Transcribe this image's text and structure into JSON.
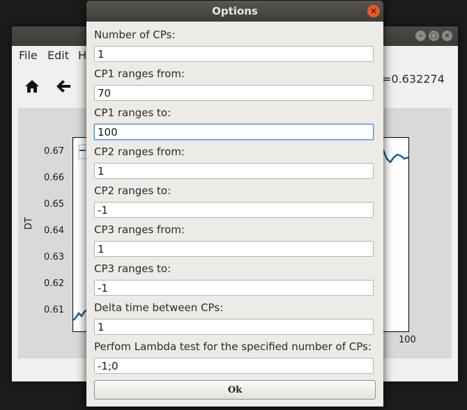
{
  "background_window": {
    "menu": [
      {
        "label": "File"
      },
      {
        "label": "Edit"
      },
      {
        "label": "H"
      }
    ],
    "toolbar": {
      "home_icon": "home-icon",
      "back_icon": "back-arrow-icon"
    },
    "coordinate_readout": "=0.632274",
    "plot": {
      "ylabel": "DT",
      "yticks": [
        "0.67",
        "0.66",
        "0.65",
        "0.64",
        "0.63",
        "0.62",
        "0.61"
      ],
      "xtick_visible": "100",
      "line_color": "#1f5f8f"
    }
  },
  "dialog": {
    "title": "Options",
    "fields": [
      {
        "label": "Number of CPs:",
        "value": "1"
      },
      {
        "label": "CP1 ranges from:",
        "value": "70"
      },
      {
        "label": "CP1 ranges to:",
        "value": "100"
      },
      {
        "label": "CP2 ranges from:",
        "value": "1"
      },
      {
        "label": "CP2 ranges to:",
        "value": "-1"
      },
      {
        "label": "CP3 ranges from:",
        "value": "1"
      },
      {
        "label": "CP3 ranges to:",
        "value": "-1"
      },
      {
        "label": "Delta time between CPs:",
        "value": "1"
      },
      {
        "label": "Perfom Lambda test for the specified number of CPs:",
        "value": "-1;0"
      }
    ],
    "ok_label": "Ok",
    "close_icon": "close-icon",
    "accent_close": "#e4572e"
  }
}
